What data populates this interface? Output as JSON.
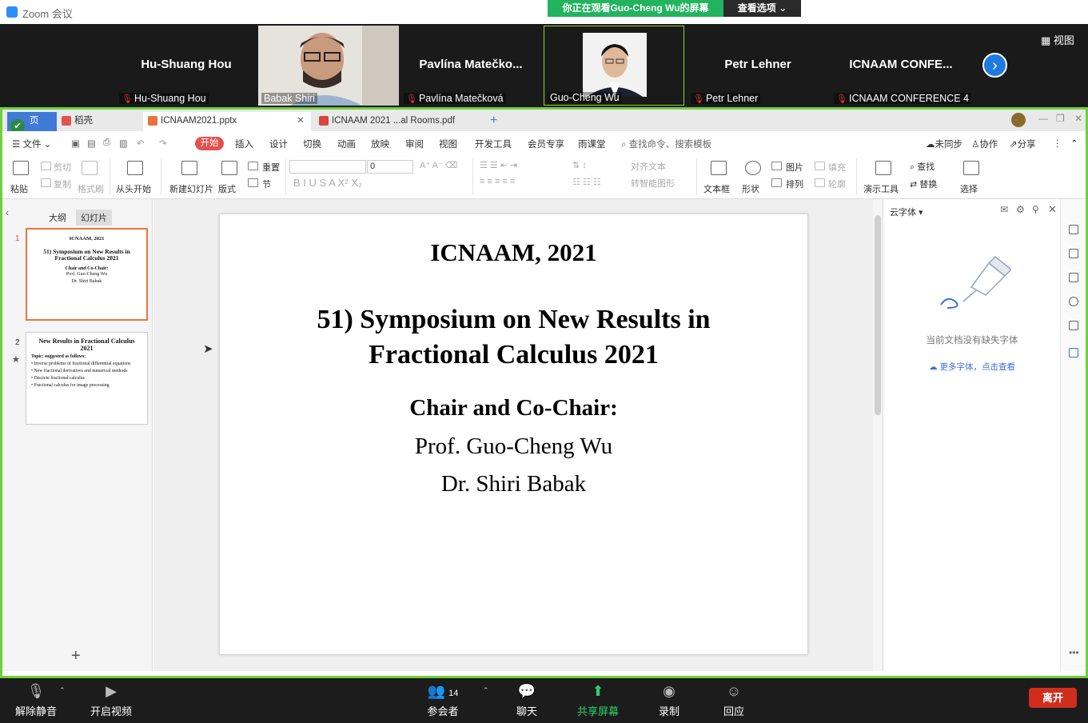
{
  "zoom": {
    "window_title": "Zoom 会议",
    "viewing_banner": "你正在观看Guo-Cheng Wu的屏幕",
    "view_options": "查看选项 ⌄",
    "gallery_view": "▦ 视图",
    "participants": [
      {
        "big": "Hu-Shuang Hou",
        "label": "Hu-Shuang Hou",
        "muted": true,
        "video": false
      },
      {
        "big": "",
        "label": "Babak Shiri",
        "muted": false,
        "video": true
      },
      {
        "big": "Pavlína  Matečko...",
        "label": "Pavlína Matečková",
        "muted": true,
        "video": false
      },
      {
        "big": "",
        "label": "Guo-Cheng Wu",
        "muted": false,
        "video": true
      },
      {
        "big": "Petr Lehner",
        "label": "Petr Lehner",
        "muted": true,
        "video": false
      },
      {
        "big": "ICNAAM  CONFE...",
        "label": "ICNAAM CONFERENCE 4",
        "muted": true,
        "video": false
      }
    ],
    "toolbar": {
      "unmute": "解除静音",
      "start_video": "开启视频",
      "participants": "参会者",
      "participants_count": "14",
      "chat": "聊天",
      "share": "共享屏幕",
      "record": "录制",
      "reactions": "回应",
      "leave": "离开"
    }
  },
  "wps": {
    "tabs": {
      "home": "页",
      "docer": "稻壳",
      "pptx": "ICNAAM2021.pptx",
      "pdf": "ICNAAM 2021 ...al Rooms.pdf",
      "new": "+"
    },
    "menu": {
      "file": "☰ 文件 ⌄",
      "start": "开始",
      "insert": "插入",
      "design": "设计",
      "transition": "切换",
      "animation": "动画",
      "show": "放映",
      "review": "审阅",
      "view": "视图",
      "dev": "开发工具",
      "vip": "会员专享",
      "rain": "雨课堂",
      "search": "查找命令、搜索模板",
      "unsynced": "未同步",
      "collab": "协作",
      "share": "分享"
    },
    "ribbon": {
      "paste": "粘贴",
      "cut": "剪切",
      "copy": "复制",
      "format_painter": "格式刷",
      "from_start": "从头开始",
      "new_slide": "新建幻灯片",
      "layout": "版式",
      "reset": "重置",
      "section": "节",
      "font_size": "0",
      "align_text": "对齐文本",
      "smartart": "转智能图形",
      "textbox": "文本框",
      "shape": "形状",
      "picture": "图片",
      "arrange": "排列",
      "fill": "填充",
      "outline": "轮廓",
      "present_tools": "演示工具",
      "find": "查找",
      "replace": "替换",
      "select": "选择"
    },
    "panel": {
      "outline_tab": "大纲",
      "slides_tab": "幻灯片",
      "add": "+"
    },
    "thumbs": [
      {
        "num": "1",
        "l1": "ICNAAM, 2021",
        "l2": "51) Symposium on New Results in Fractional Calculus 2021",
        "l3": "Chair and Co-Chair:",
        "l4": "Prof. Guo-Cheng Wu",
        "l5": "Dr. Shiri Babak"
      },
      {
        "num": "2",
        "title": "New Results in Fractional Calculus 2021",
        "topic": "Topic: suggested as follows:",
        "bullets": [
          "• Inverse problems of fractional differential equations",
          "• New fractional derivatives and numerical methods",
          "• Discrete fractional calculus",
          "• Fractional calculus for image processing"
        ]
      }
    ],
    "slide": {
      "title": "ICNAAM, 2021",
      "subtitle": "51) Symposium on New Results in Fractional Calculus 2021",
      "chair_heading": "Chair and Co-Chair:",
      "person1": "Prof. Guo-Cheng Wu",
      "person2": "Dr. Shiri Babak"
    },
    "font_panel": {
      "title": "云字体 ▾",
      "empty": "当前文档没有缺失字体",
      "more": "更多字体，点击查看"
    }
  },
  "colors": {
    "zoom_green": "#22b35e",
    "share_border": "#6fcf3c",
    "wps_accent": "#e3514d",
    "leave_red": "#d02d1d"
  }
}
